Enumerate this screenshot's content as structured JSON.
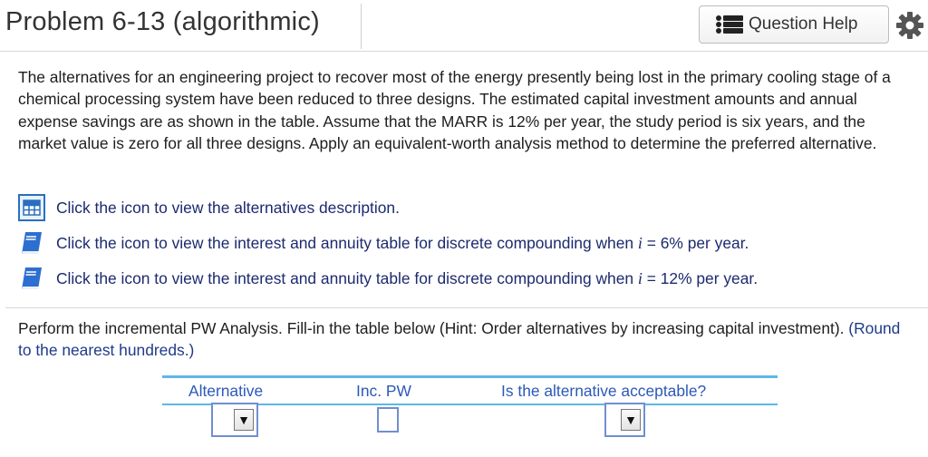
{
  "header": {
    "title": "Problem 6-13 (algorithmic)",
    "question_help_label": "Question Help"
  },
  "problem_text": "The alternatives for an engineering project to recover most of the energy presently being lost in the primary cooling stage of a chemical processing system have been reduced to three designs. The estimated capital investment amounts and annual expense savings are as shown in the table. Assume that the MARR is 12% per year, the study period is six years, and the market value is zero for all three designs. Apply an equivalent-worth analysis method to determine the preferred alternative.",
  "links": [
    {
      "icon": "table-icon",
      "text": "Click the icon to view the alternatives description."
    },
    {
      "icon": "book-icon",
      "prefix": "Click the icon to view the interest and annuity table for discrete compounding when ",
      "var": "i",
      "suffix": " = 6% per year."
    },
    {
      "icon": "book-icon",
      "prefix": "Click the icon to view the interest and annuity table for discrete compounding when ",
      "var": "i",
      "suffix": " = 12% per year."
    }
  ],
  "instruction": {
    "text": "Perform the incremental PW Analysis. Fill-in the table below (Hint: Order alternatives by increasing capital investment).",
    "hint": "(Round to the nearest hundreds.)"
  },
  "answer_table": {
    "headers": [
      "Alternative",
      "Inc. PW",
      "Is the alternative acceptable?"
    ],
    "row": {
      "alternative": "",
      "inc_pw": "",
      "acceptable": ""
    }
  },
  "colors": {
    "link_text": "#1c2a6e",
    "table_header_text": "#2c59b8",
    "table_rule": "#5fb6e6",
    "input_border": "#6f8fd1"
  }
}
